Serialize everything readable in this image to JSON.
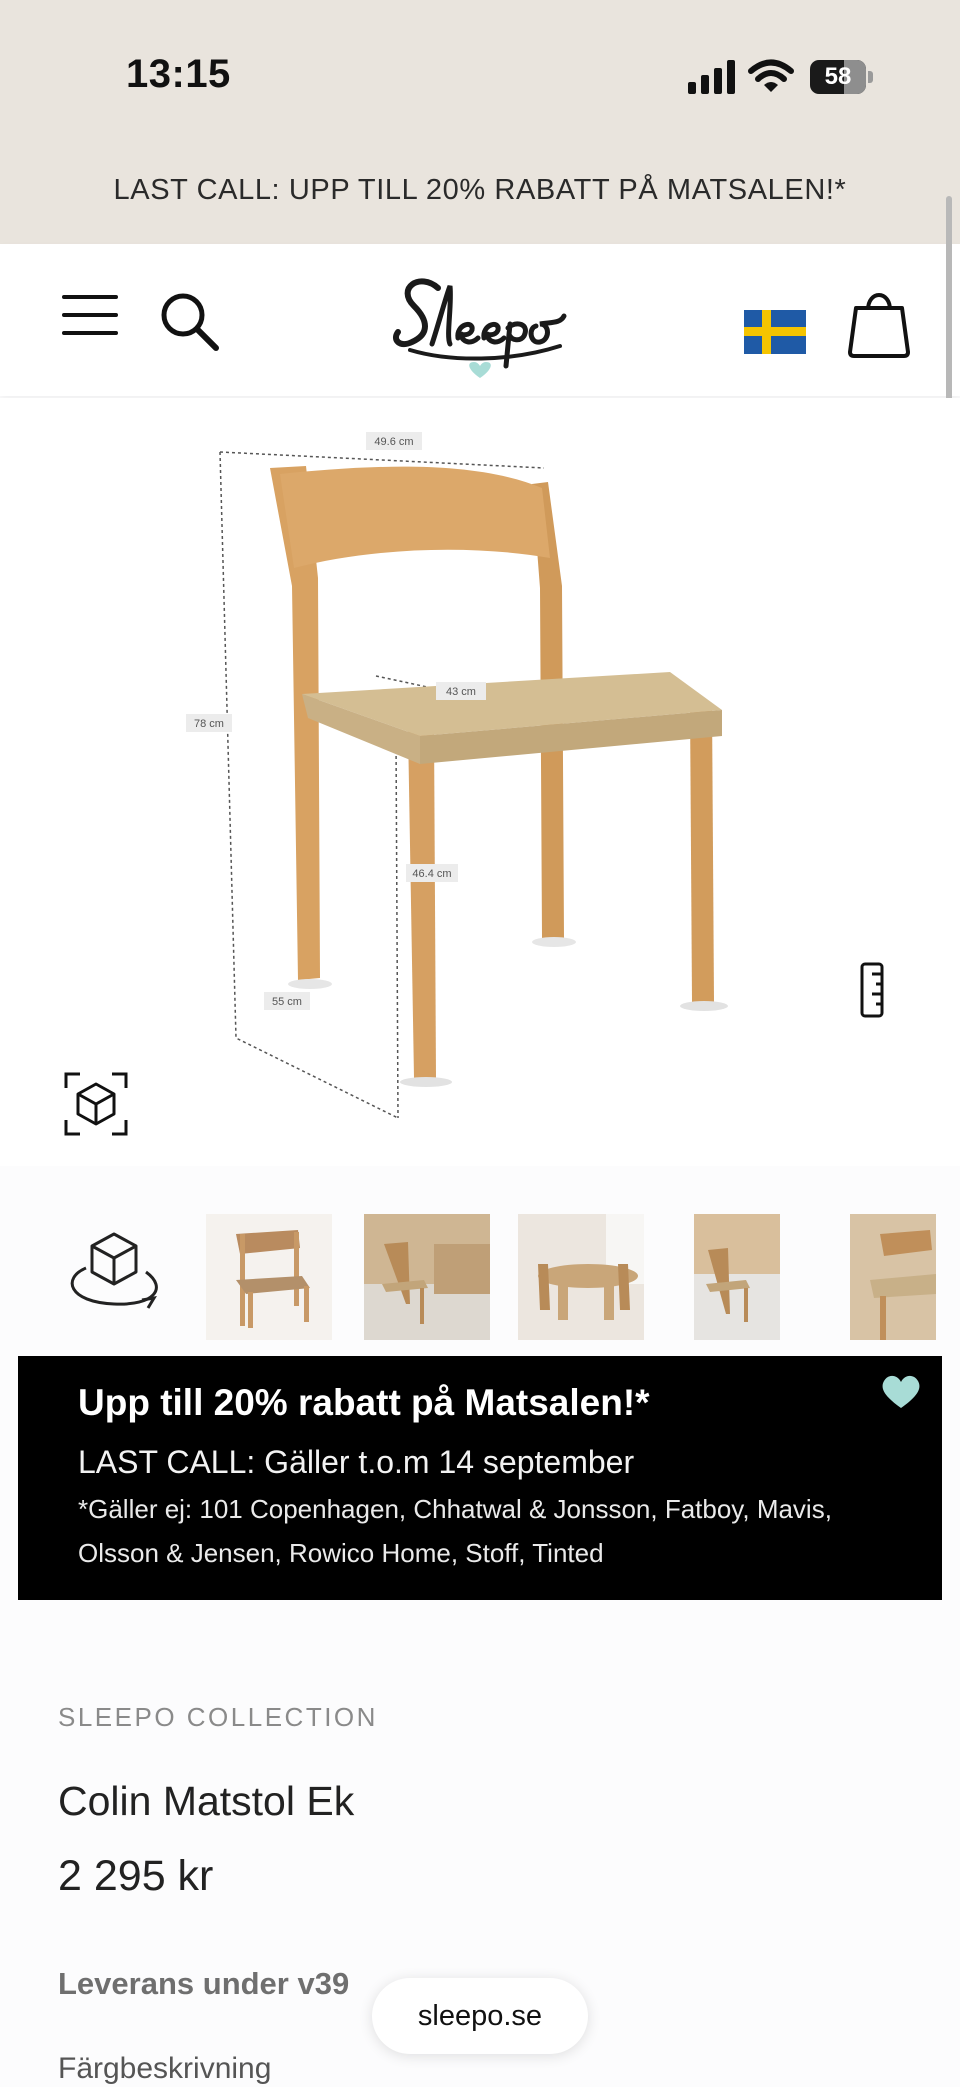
{
  "status_bar": {
    "time": "13:15",
    "battery": "58"
  },
  "promo_banner": {
    "text": "LAST CALL: UPP TILL 20% RABATT PÅ MATSALEN!*"
  },
  "header": {
    "menu_icon": "hamburger-menu-icon",
    "search_icon": "search-icon",
    "logo": "Sleepo",
    "flag": "sweden-flag-icon",
    "cart_icon": "shopping-bag-icon"
  },
  "product_image": {
    "dimension_labels": {
      "width": "49.6 cm",
      "height": "78 cm",
      "seat_depth": "43 cm",
      "seat_height": "46.4 cm",
      "depth": "55 cm"
    },
    "ruler_icon": "ruler-icon",
    "ar_icon": "ar-cube-icon"
  },
  "thumbnails": {
    "view_3d_icon": "rotate-3d-cube-icon",
    "count": 5
  },
  "campaign": {
    "title": "Upp till 20% rabatt på Matsalen!*",
    "subtitle": "LAST CALL: Gäller t.o.m 14 september",
    "note_line1": "*Gäller ej: 101 Copenhagen, Chhatwal & Jonsson, Fatboy, Mavis,",
    "note_line2": "Olsson & Jensen, Rowico Home, Stoff, Tinted",
    "heart_color": "#a8dcd6"
  },
  "product": {
    "brand": "SLEEPO COLLECTION",
    "name": "Colin Matstol Ek",
    "price": "2 295 kr",
    "delivery": "Leverans under v39",
    "color_description_label": "Färgbeskrivning"
  },
  "browser": {
    "url": "sleepo.se"
  },
  "colors": {
    "top_band": "#e9e4dd",
    "wood": "#d9a56a",
    "seat_cord": "#d2b98c"
  }
}
